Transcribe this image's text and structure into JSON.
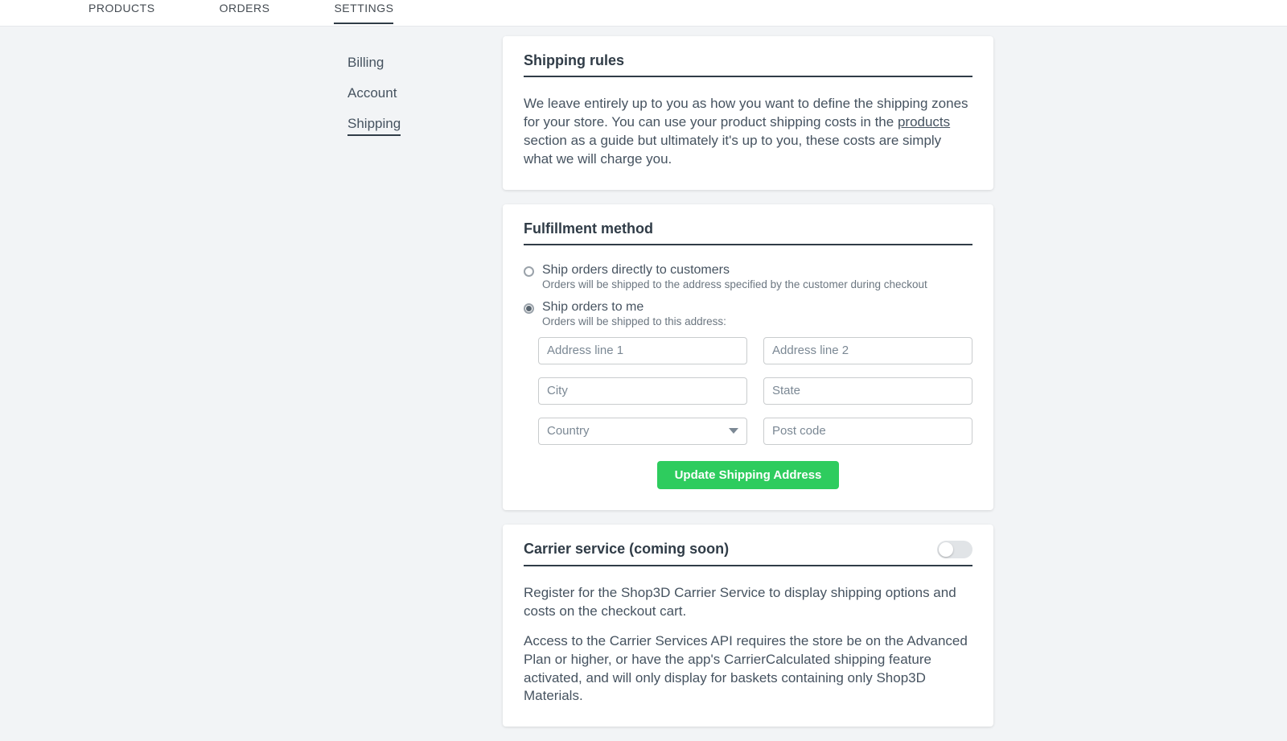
{
  "topnav": {
    "items": [
      {
        "label": "PRODUCTS",
        "active": false
      },
      {
        "label": "ORDERS",
        "active": false
      },
      {
        "label": "SETTINGS",
        "active": true
      }
    ]
  },
  "sidebar": {
    "items": [
      {
        "label": "Billing",
        "active": false
      },
      {
        "label": "Account",
        "active": false
      },
      {
        "label": "Shipping",
        "active": true
      }
    ]
  },
  "shipping_rules": {
    "title": "Shipping rules",
    "text_a": "We leave entirely up to you as how you want to define the shipping zones for your store. You can use your product shipping costs in the ",
    "link": "products",
    "text_b": " section as a guide but ultimately it's up to you, these costs are simply what we will charge you."
  },
  "fulfillment": {
    "title": "Fulfillment method",
    "options": [
      {
        "label": "Ship orders directly to customers",
        "sub": "Orders will be shipped to the address specified by the customer during checkout",
        "checked": false
      },
      {
        "label": "Ship orders to me",
        "sub": "Orders will be shipped to this address:",
        "checked": true
      }
    ],
    "fields": {
      "addr1": "Address line 1",
      "addr2": "Address line 2",
      "city": "City",
      "state": "State",
      "country": "Country",
      "postcode": "Post code"
    },
    "button": "Update Shipping Address"
  },
  "carrier": {
    "title": "Carrier service (coming soon)",
    "toggle_on": false,
    "p1": "Register for the Shop3D Carrier Service to display shipping options and costs on the checkout cart.",
    "p2": "Access to the Carrier Services API requires the store be on the Advanced Plan or higher, or have the app's CarrierCalculated shipping feature activated, and will only display for baskets containing only Shop3D Materials."
  }
}
